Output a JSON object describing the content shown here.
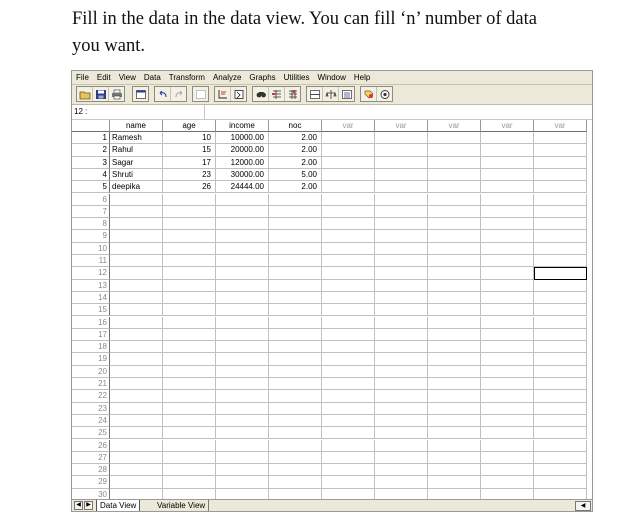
{
  "caption": {
    "line1": "Fill in the data in the data view. You can fill ‘n’ number of data",
    "line2": "you want."
  },
  "menu": [
    "File",
    "Edit",
    "View",
    "Data",
    "Transform",
    "Analyze",
    "Graphs",
    "Utilities",
    "Window",
    "Help"
  ],
  "toolbar_icons": [
    "open-icon",
    "save-icon",
    "print-icon",
    "dialog-recall-icon",
    "undo-icon",
    "redo-icon",
    "goto-chart-icon",
    "goto-case-icon",
    "variables-icon",
    "find-icon",
    "insert-cases-icon",
    "insert-variable-icon",
    "split-file-icon",
    "weight-cases-icon",
    "select-cases-icon",
    "value-labels-icon",
    "use-sets-icon"
  ],
  "cell_ref": "12 :",
  "columns": [
    "name",
    "age",
    "income",
    "noc",
    "var",
    "var",
    "var",
    "var",
    "var"
  ],
  "rows": [
    {
      "num": "1",
      "name": "Ramesh",
      "age": "10",
      "income": "10000.00",
      "noc": "2.00"
    },
    {
      "num": "2",
      "name": "Rahul",
      "age": "15",
      "income": "20000.00",
      "noc": "2.00"
    },
    {
      "num": "3",
      "name": "Sagar",
      "age": "17",
      "income": "12000.00",
      "noc": "2.00"
    },
    {
      "num": "4",
      "name": "Shruti",
      "age": "23",
      "income": "30000.00",
      "noc": "5.00"
    },
    {
      "num": "5",
      "name": "deepika",
      "age": "26",
      "income": "24444.00",
      "noc": "2.00"
    }
  ],
  "empty_rows": [
    "6",
    "7",
    "8",
    "9",
    "10",
    "11",
    "12",
    "13",
    "14",
    "15",
    "16",
    "17",
    "18",
    "19",
    "20",
    "21",
    "22",
    "23",
    "24",
    "25",
    "26",
    "27",
    "28",
    "29",
    "30"
  ],
  "tabs": {
    "data_view": "Data View",
    "variable_view": "Variable View"
  },
  "nav": {
    "prev": "◀",
    "next": "▶",
    "scroll_left": "◀"
  }
}
